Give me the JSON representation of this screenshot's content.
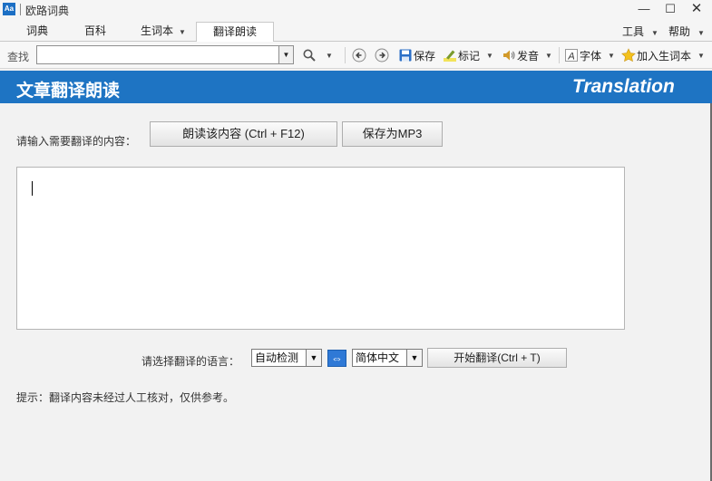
{
  "window": {
    "app_icon": "Aa",
    "title": "欧路词典",
    "minimize_glyph": "—",
    "maximize_glyph": "☐",
    "close_glyph": "✕"
  },
  "tabs": [
    {
      "label": "词典"
    },
    {
      "label": "百科"
    },
    {
      "label": "生词本",
      "dropdown": true
    },
    {
      "label": "翻译朗读",
      "active": true
    }
  ],
  "menus": {
    "tools": "工具",
    "help": "帮助"
  },
  "toolbar": {
    "search_label": "查找",
    "search_value": "",
    "save": "保存",
    "mark": "标记",
    "pronounce": "发音",
    "font": "字体",
    "add_wordbook": "加入生词本"
  },
  "banner": {
    "title_cn": "文章翻译朗读",
    "title_en": "Translation"
  },
  "main": {
    "prompt": "请输入需要翻译的内容：",
    "read_button": "朗读该内容 (Ctrl + F12)",
    "save_mp3_button": "保存为MP3",
    "input_text": "",
    "lang_label": "请选择翻译的语言：",
    "source_lang": "自动检测",
    "target_lang": "简体中文",
    "swap_glyph": "⇔",
    "translate_button": "开始翻译(Ctrl + T)",
    "hint": "提示：翻译内容未经过人工核对，仅供参考。"
  },
  "colors": {
    "banner_bg": "#1e74c3",
    "swap_bg": "#2f79d6"
  }
}
